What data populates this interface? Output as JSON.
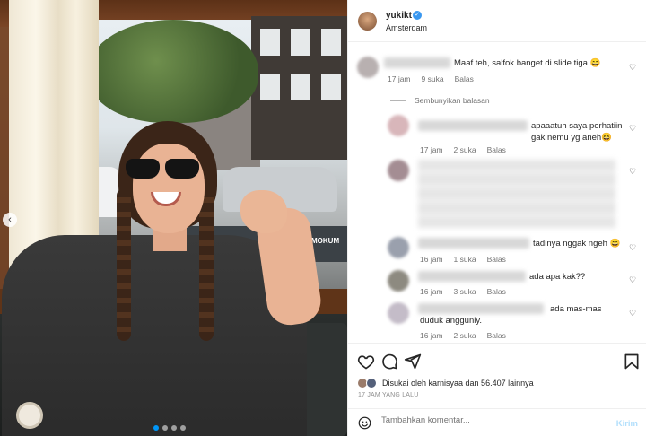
{
  "post": {
    "username": "yukikt",
    "location": "Amsterdam",
    "verified_icon": "verified-badge-icon",
    "boat_sign": "MOKUM"
  },
  "comments": [
    {
      "text": "Maaf teh, salfok banget di slide tiga.😄",
      "time": "17 jam",
      "likes": "9 suka",
      "reply_label": "Balas"
    }
  ],
  "replies_toggle": "Sembunyikan balasan",
  "replies": [
    {
      "text": "apaaatuh saya perhatiin gak nemu yg aneh😆",
      "time": "17 jam",
      "likes": "2 suka",
      "reply_label": "Balas"
    },
    {
      "text": "",
      "time": "",
      "likes": "",
      "reply_label": ""
    },
    {
      "text": "tadinya nggak ngeh 😄",
      "time": "16 jam",
      "likes": "1 suka",
      "reply_label": "Balas"
    },
    {
      "text": "ada apa kak??",
      "time": "16 jam",
      "likes": "3 suka",
      "reply_label": "Balas"
    },
    {
      "text": "ada mas-mas duduk anggunly.",
      "time": "16 jam",
      "likes": "2 suka",
      "reply_label": "Balas"
    }
  ],
  "likes_summary": "Disukai oleh karnisyaa dan 56.407 lainnya",
  "time_ago": "17 JAM YANG LALU",
  "comment_box": {
    "placeholder": "Tambahkan komentar...",
    "post_label": "Kirim"
  },
  "colors": {
    "accent": "#0095f6",
    "verified": "#3897f0",
    "muted": "#737373"
  }
}
